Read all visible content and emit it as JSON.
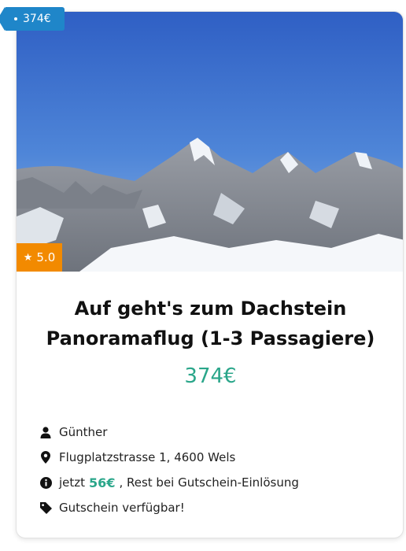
{
  "ribbon": {
    "price": "374€"
  },
  "rating": {
    "value": "5.0",
    "icon": "star-icon"
  },
  "offer": {
    "title_line1": "Auf geht's zum Dachstein",
    "title_line2": "Panoramaflug (1-3 Passagiere)",
    "price": "374€"
  },
  "details": {
    "provider": "Günther",
    "address": "Flugplatzstrasse 1, 4600 Wels",
    "payment_prefix": "jetzt",
    "payment_amount": "56€",
    "payment_suffix": ", Rest bei Gutschein-Einlösung",
    "voucher": "Gutschein verfügbar!"
  },
  "colors": {
    "accent": "#2aa68a",
    "ribbon": "#1f86c9",
    "rating": "#f28a00"
  }
}
